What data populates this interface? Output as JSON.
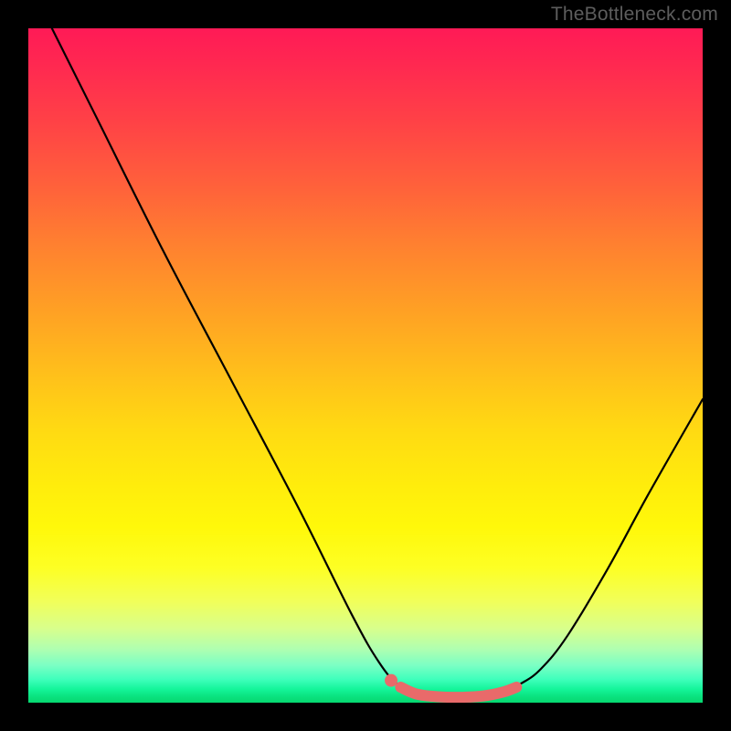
{
  "attribution": "TheBottleneck.com",
  "chart_data": {
    "type": "line",
    "title": "",
    "xlabel": "",
    "ylabel": "",
    "xlim": [
      0,
      100
    ],
    "ylim": [
      0,
      100
    ],
    "series": [
      {
        "name": "curve",
        "color": "#000000",
        "points": [
          {
            "x": 3.5,
            "y": 100
          },
          {
            "x": 10,
            "y": 87
          },
          {
            "x": 20,
            "y": 67
          },
          {
            "x": 30,
            "y": 48
          },
          {
            "x": 40,
            "y": 29
          },
          {
            "x": 48,
            "y": 13
          },
          {
            "x": 52,
            "y": 6
          },
          {
            "x": 55,
            "y": 2.5
          },
          {
            "x": 58,
            "y": 1.2
          },
          {
            "x": 62,
            "y": 0.8
          },
          {
            "x": 66,
            "y": 0.8
          },
          {
            "x": 70,
            "y": 1.4
          },
          {
            "x": 73,
            "y": 2.8
          },
          {
            "x": 76,
            "y": 5
          },
          {
            "x": 80,
            "y": 10
          },
          {
            "x": 86,
            "y": 20
          },
          {
            "x": 92,
            "y": 31
          },
          {
            "x": 100,
            "y": 45
          }
        ]
      },
      {
        "name": "highlight",
        "color": "#e96a6a",
        "points": [
          {
            "x": 55.2,
            "y": 2.3
          },
          {
            "x": 57.5,
            "y": 1.3
          },
          {
            "x": 60.5,
            "y": 0.9
          },
          {
            "x": 64.0,
            "y": 0.8
          },
          {
            "x": 67.5,
            "y": 1.0
          },
          {
            "x": 70.5,
            "y": 1.6
          },
          {
            "x": 72.4,
            "y": 2.3
          }
        ]
      },
      {
        "name": "highlight-dot",
        "color": "#e96a6a",
        "points": [
          {
            "x": 53.8,
            "y": 3.3
          }
        ]
      }
    ],
    "gradient_stops": [
      {
        "pos": 0,
        "color": "#ff1a56"
      },
      {
        "pos": 50,
        "color": "#ffc21a"
      },
      {
        "pos": 80,
        "color": "#fdff24"
      },
      {
        "pos": 100,
        "color": "#06d86f"
      }
    ]
  }
}
